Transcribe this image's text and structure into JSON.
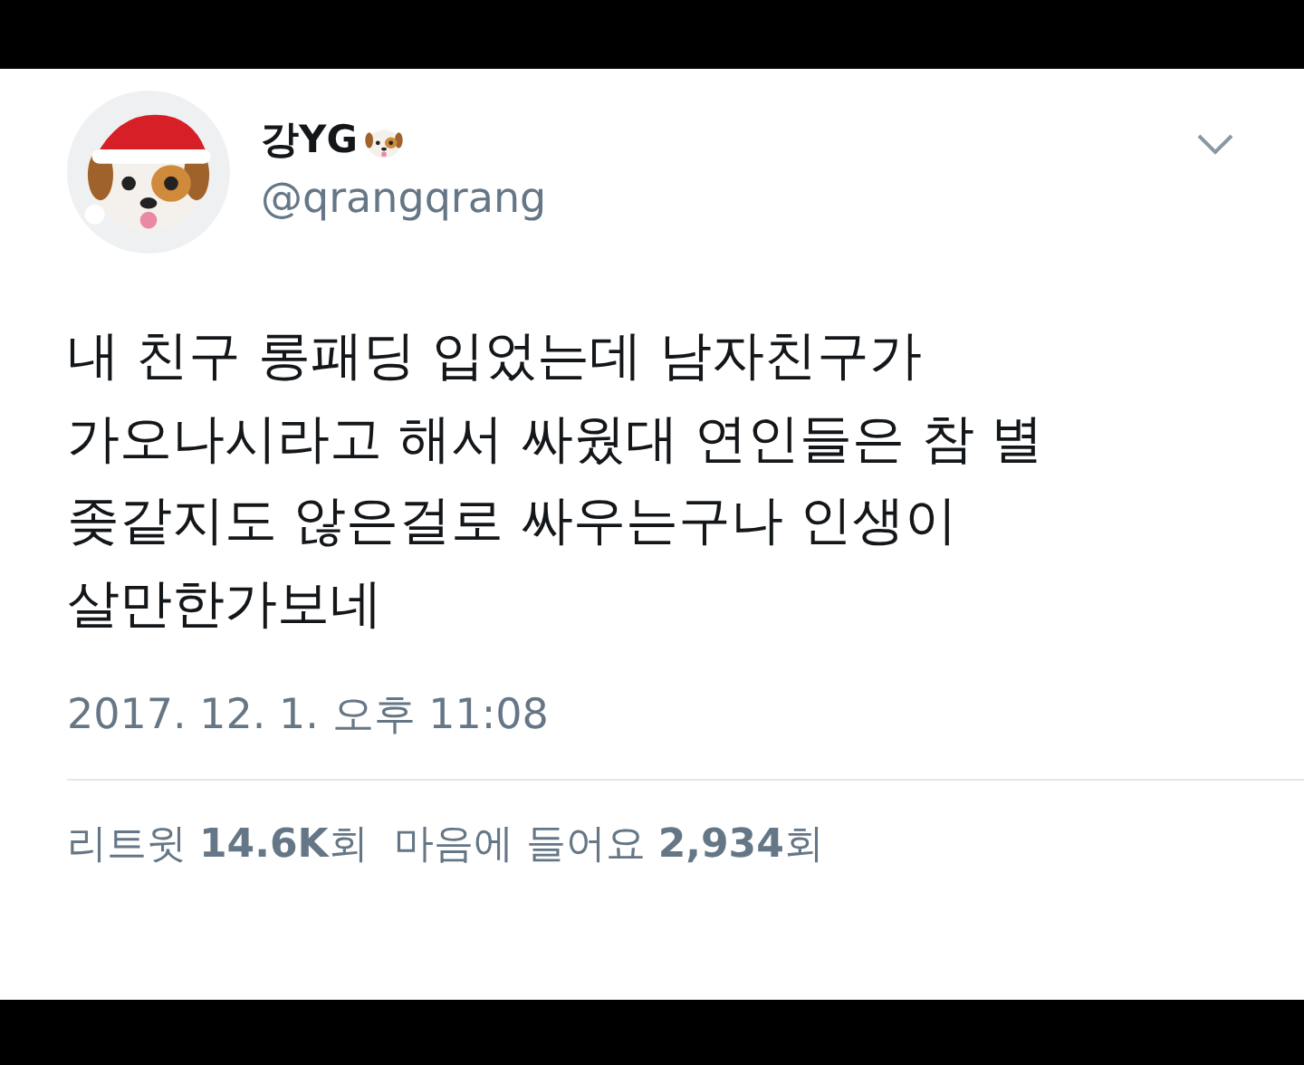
{
  "tweet": {
    "display_name": "강YG",
    "handle": "@qrangqrang",
    "text_lines": [
      "내 친구 롱패딩 입었는데 남자친구가",
      "가오나시라고 해서 싸웠대 연인들은 참 별",
      "좆같지도 않은걸로 싸우는구나 인생이",
      "살만한가보네"
    ],
    "timestamp": "2017. 12. 1. 오후 11:08",
    "stats": [
      "리트윗 **14.6K**회",
      "마음에 들어요 **2,934**회"
    ]
  }
}
